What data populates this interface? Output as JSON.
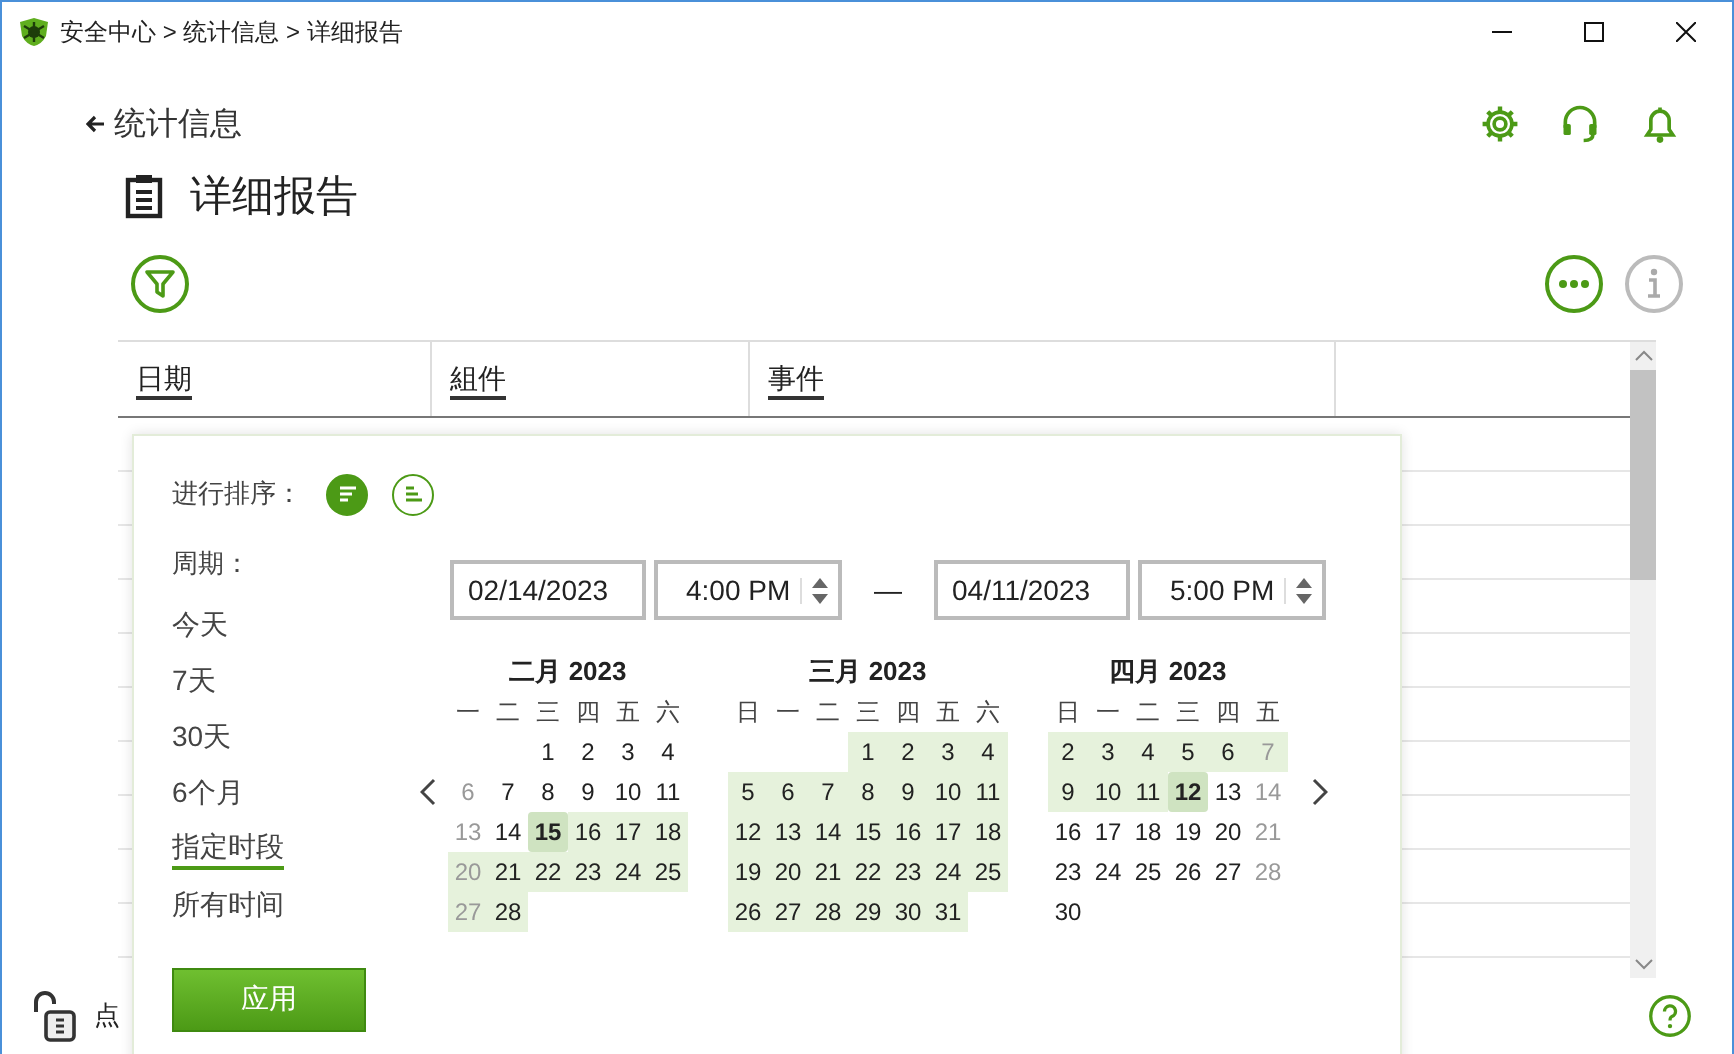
{
  "window": {
    "title": "安全中心 > 统计信息 > 详细报告"
  },
  "back_link": {
    "label": "统计信息"
  },
  "page_title": "详细报告",
  "table": {
    "columns": [
      "日期",
      "組件",
      "事件"
    ]
  },
  "filter_popup": {
    "sort_label": "进行排序：",
    "sort_buttons": [
      {
        "selected": true
      },
      {
        "selected": false
      }
    ],
    "period_label": "周期：",
    "periods": [
      {
        "label": "今天",
        "selected": false
      },
      {
        "label": "7天",
        "selected": false
      },
      {
        "label": "30天",
        "selected": false
      },
      {
        "label": "6个月",
        "selected": false
      },
      {
        "label": "指定时段",
        "selected": true
      },
      {
        "label": "所有时间",
        "selected": false
      }
    ],
    "from_date": "02/14/2023",
    "from_time": "4:00 PM",
    "dash": "—",
    "to_date": "04/11/2023",
    "to_time": "5:00 PM",
    "months": [
      {
        "title": "二月 2023",
        "weekdays": [
          "一",
          "二",
          "三",
          "四",
          "五",
          "六"
        ],
        "weeks": [
          [
            {
              "kind": "blank"
            },
            {
              "kind": "blank"
            },
            {
              "kind": "day",
              "day": "1",
              "in_range": false,
              "selected": false,
              "dimmed": false
            },
            {
              "kind": "day",
              "day": "2",
              "in_range": false,
              "selected": false,
              "dimmed": false
            },
            {
              "kind": "day",
              "day": "3",
              "in_range": false,
              "selected": false,
              "dimmed": false
            },
            {
              "kind": "day",
              "day": "4",
              "in_range": false,
              "selected": false,
              "dimmed": false
            }
          ],
          [
            {
              "kind": "day",
              "day": "6",
              "in_range": false,
              "selected": false,
              "dimmed": true
            },
            {
              "kind": "day",
              "day": "7",
              "in_range": false,
              "selected": false,
              "dimmed": false
            },
            {
              "kind": "day",
              "day": "8",
              "in_range": false,
              "selected": false,
              "dimmed": false
            },
            {
              "kind": "day",
              "day": "9",
              "in_range": false,
              "selected": false,
              "dimmed": false
            },
            {
              "kind": "day",
              "day": "10",
              "in_range": false,
              "selected": false,
              "dimmed": false
            },
            {
              "kind": "day",
              "day": "11",
              "in_range": false,
              "selected": false,
              "dimmed": false
            }
          ],
          [
            {
              "kind": "day",
              "day": "13",
              "in_range": false,
              "selected": false,
              "dimmed": true
            },
            {
              "kind": "day",
              "day": "14",
              "in_range": false,
              "selected": false,
              "dimmed": false
            },
            {
              "kind": "day",
              "day": "15",
              "in_range": true,
              "selected": true,
              "dimmed": false
            },
            {
              "kind": "day",
              "day": "16",
              "in_range": true,
              "selected": false,
              "dimmed": false
            },
            {
              "kind": "day",
              "day": "17",
              "in_range": true,
              "selected": false,
              "dimmed": false
            },
            {
              "kind": "day",
              "day": "18",
              "in_range": true,
              "selected": false,
              "dimmed": false
            }
          ],
          [
            {
              "kind": "day",
              "day": "20",
              "in_range": true,
              "selected": false,
              "dimmed": true
            },
            {
              "kind": "day",
              "day": "21",
              "in_range": true,
              "selected": false,
              "dimmed": false
            },
            {
              "kind": "day",
              "day": "22",
              "in_range": true,
              "selected": false,
              "dimmed": false
            },
            {
              "kind": "day",
              "day": "23",
              "in_range": true,
              "selected": false,
              "dimmed": false
            },
            {
              "kind": "day",
              "day": "24",
              "in_range": true,
              "selected": false,
              "dimmed": false
            },
            {
              "kind": "day",
              "day": "25",
              "in_range": true,
              "selected": false,
              "dimmed": false
            }
          ],
          [
            {
              "kind": "day",
              "day": "27",
              "in_range": true,
              "selected": false,
              "dimmed": true
            },
            {
              "kind": "day",
              "day": "28",
              "in_range": true,
              "selected": false,
              "dimmed": false
            },
            {
              "kind": "blank"
            },
            {
              "kind": "blank"
            },
            {
              "kind": "blank"
            },
            {
              "kind": "blank"
            }
          ]
        ]
      },
      {
        "title": "三月 2023",
        "weekdays": [
          "日",
          "一",
          "二",
          "三",
          "四",
          "五",
          "六"
        ],
        "weeks": [
          [
            {
              "kind": "blank"
            },
            {
              "kind": "blank"
            },
            {
              "kind": "blank"
            },
            {
              "kind": "day",
              "day": "1",
              "in_range": true,
              "selected": false,
              "dimmed": false
            },
            {
              "kind": "day",
              "day": "2",
              "in_range": true,
              "selected": false,
              "dimmed": false
            },
            {
              "kind": "day",
              "day": "3",
              "in_range": true,
              "selected": false,
              "dimmed": false
            },
            {
              "kind": "day",
              "day": "4",
              "in_range": true,
              "selected": false,
              "dimmed": false
            }
          ],
          [
            {
              "kind": "day",
              "day": "5",
              "in_range": true,
              "selected": false,
              "dimmed": false
            },
            {
              "kind": "day",
              "day": "6",
              "in_range": true,
              "selected": false,
              "dimmed": false
            },
            {
              "kind": "day",
              "day": "7",
              "in_range": true,
              "selected": false,
              "dimmed": false
            },
            {
              "kind": "day",
              "day": "8",
              "in_range": true,
              "selected": false,
              "dimmed": false
            },
            {
              "kind": "day",
              "day": "9",
              "in_range": true,
              "selected": false,
              "dimmed": false
            },
            {
              "kind": "day",
              "day": "10",
              "in_range": true,
              "selected": false,
              "dimmed": false
            },
            {
              "kind": "day",
              "day": "11",
              "in_range": true,
              "selected": false,
              "dimmed": false
            }
          ],
          [
            {
              "kind": "day",
              "day": "12",
              "in_range": true,
              "selected": false,
              "dimmed": false
            },
            {
              "kind": "day",
              "day": "13",
              "in_range": true,
              "selected": false,
              "dimmed": false
            },
            {
              "kind": "day",
              "day": "14",
              "in_range": true,
              "selected": false,
              "dimmed": false
            },
            {
              "kind": "day",
              "day": "15",
              "in_range": true,
              "selected": false,
              "dimmed": false
            },
            {
              "kind": "day",
              "day": "16",
              "in_range": true,
              "selected": false,
              "dimmed": false
            },
            {
              "kind": "day",
              "day": "17",
              "in_range": true,
              "selected": false,
              "dimmed": false
            },
            {
              "kind": "day",
              "day": "18",
              "in_range": true,
              "selected": false,
              "dimmed": false
            }
          ],
          [
            {
              "kind": "day",
              "day": "19",
              "in_range": true,
              "selected": false,
              "dimmed": false
            },
            {
              "kind": "day",
              "day": "20",
              "in_range": true,
              "selected": false,
              "dimmed": false
            },
            {
              "kind": "day",
              "day": "21",
              "in_range": true,
              "selected": false,
              "dimmed": false
            },
            {
              "kind": "day",
              "day": "22",
              "in_range": true,
              "selected": false,
              "dimmed": false
            },
            {
              "kind": "day",
              "day": "23",
              "in_range": true,
              "selected": false,
              "dimmed": false
            },
            {
              "kind": "day",
              "day": "24",
              "in_range": true,
              "selected": false,
              "dimmed": false
            },
            {
              "kind": "day",
              "day": "25",
              "in_range": true,
              "selected": false,
              "dimmed": false
            }
          ],
          [
            {
              "kind": "day",
              "day": "26",
              "in_range": true,
              "selected": false,
              "dimmed": false
            },
            {
              "kind": "day",
              "day": "27",
              "in_range": true,
              "selected": false,
              "dimmed": false
            },
            {
              "kind": "day",
              "day": "28",
              "in_range": true,
              "selected": false,
              "dimmed": false
            },
            {
              "kind": "day",
              "day": "29",
              "in_range": true,
              "selected": false,
              "dimmed": false
            },
            {
              "kind": "day",
              "day": "30",
              "in_range": true,
              "selected": false,
              "dimmed": false
            },
            {
              "kind": "day",
              "day": "31",
              "in_range": true,
              "selected": false,
              "dimmed": false
            },
            {
              "kind": "blank"
            }
          ]
        ]
      },
      {
        "title": "四月 2023",
        "weekdays": [
          "日",
          "一",
          "二",
          "三",
          "四",
          "五"
        ],
        "weeks": [
          [
            {
              "kind": "day",
              "day": "2",
              "in_range": true,
              "selected": false,
              "dimmed": false
            },
            {
              "kind": "day",
              "day": "3",
              "in_range": true,
              "selected": false,
              "dimmed": false
            },
            {
              "kind": "day",
              "day": "4",
              "in_range": true,
              "selected": false,
              "dimmed": false
            },
            {
              "kind": "day",
              "day": "5",
              "in_range": true,
              "selected": false,
              "dimmed": false
            },
            {
              "kind": "day",
              "day": "6",
              "in_range": true,
              "selected": false,
              "dimmed": false
            },
            {
              "kind": "day",
              "day": "7",
              "in_range": true,
              "selected": false,
              "dimmed": true
            }
          ],
          [
            {
              "kind": "day",
              "day": "9",
              "in_range": true,
              "selected": false,
              "dimmed": false
            },
            {
              "kind": "day",
              "day": "10",
              "in_range": true,
              "selected": false,
              "dimmed": false
            },
            {
              "kind": "day",
              "day": "11",
              "in_range": true,
              "selected": false,
              "dimmed": false
            },
            {
              "kind": "day",
              "day": "12",
              "in_range": true,
              "selected": true,
              "dimmed": false
            },
            {
              "kind": "day",
              "day": "13",
              "in_range": false,
              "selected": false,
              "dimmed": false
            },
            {
              "kind": "day",
              "day": "14",
              "in_range": false,
              "selected": false,
              "dimmed": true
            }
          ],
          [
            {
              "kind": "day",
              "day": "16",
              "in_range": false,
              "selected": false,
              "dimmed": false
            },
            {
              "kind": "day",
              "day": "17",
              "in_range": false,
              "selected": false,
              "dimmed": false
            },
            {
              "kind": "day",
              "day": "18",
              "in_range": false,
              "selected": false,
              "dimmed": false
            },
            {
              "kind": "day",
              "day": "19",
              "in_range": false,
              "selected": false,
              "dimmed": false
            },
            {
              "kind": "day",
              "day": "20",
              "in_range": false,
              "selected": false,
              "dimmed": false
            },
            {
              "kind": "day",
              "day": "21",
              "in_range": false,
              "selected": false,
              "dimmed": true
            }
          ],
          [
            {
              "kind": "day",
              "day": "23",
              "in_range": false,
              "selected": false,
              "dimmed": false
            },
            {
              "kind": "day",
              "day": "24",
              "in_range": false,
              "selected": false,
              "dimmed": false
            },
            {
              "kind": "day",
              "day": "25",
              "in_range": false,
              "selected": false,
              "dimmed": false
            },
            {
              "kind": "day",
              "day": "26",
              "in_range": false,
              "selected": false,
              "dimmed": false
            },
            {
              "kind": "day",
              "day": "27",
              "in_range": false,
              "selected": false,
              "dimmed": false
            },
            {
              "kind": "day",
              "day": "28",
              "in_range": false,
              "selected": false,
              "dimmed": true
            }
          ],
          [
            {
              "kind": "day",
              "day": "30",
              "in_range": false,
              "selected": false,
              "dimmed": false
            }
          ]
        ]
      }
    ],
    "apply": "应用"
  },
  "status": {
    "text": "点"
  }
}
